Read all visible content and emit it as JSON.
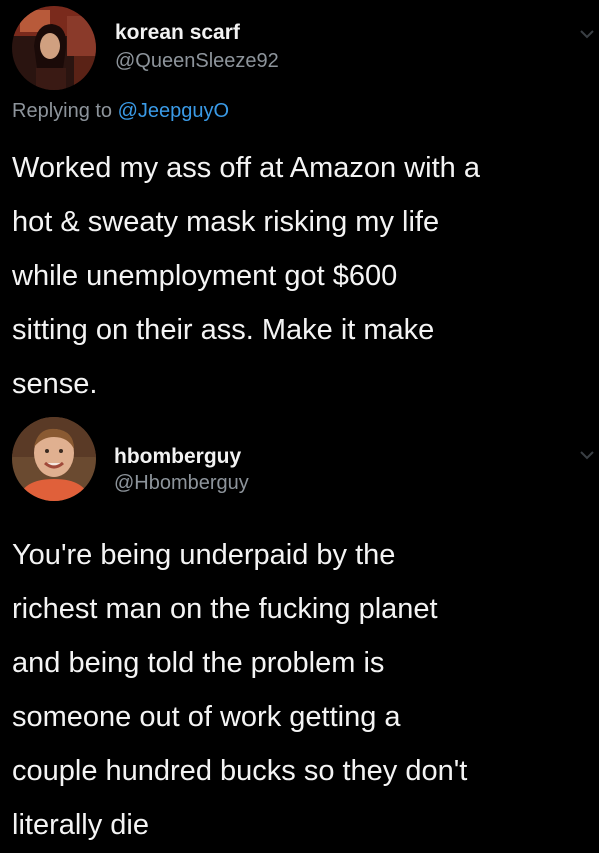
{
  "tweets": [
    {
      "display_name": "korean scarf",
      "handle": "@QueenSleeze92",
      "reply_prefix": "Replying to ",
      "reply_to": "@JeepguyO",
      "text": "Worked my ass off at Amazon with a\nhot & sweaty mask risking my life\nwhile unemployment got $600\nsitting on their ass. Make it make\nsense."
    },
    {
      "display_name": "hbomberguy",
      "handle": "@Hbomberguy",
      "text": "You're being underpaid by the\nrichest man on the fucking planet\nand being told the problem is\nsomeone out of work getting a\ncouple hundred bucks so they don't\nliterally die"
    }
  ],
  "colors": {
    "background": "#000000",
    "text": "#f4f4f4",
    "muted": "#8d949b",
    "link": "#3a9ae6"
  },
  "icons": {
    "menu": "chevron-down-icon"
  }
}
